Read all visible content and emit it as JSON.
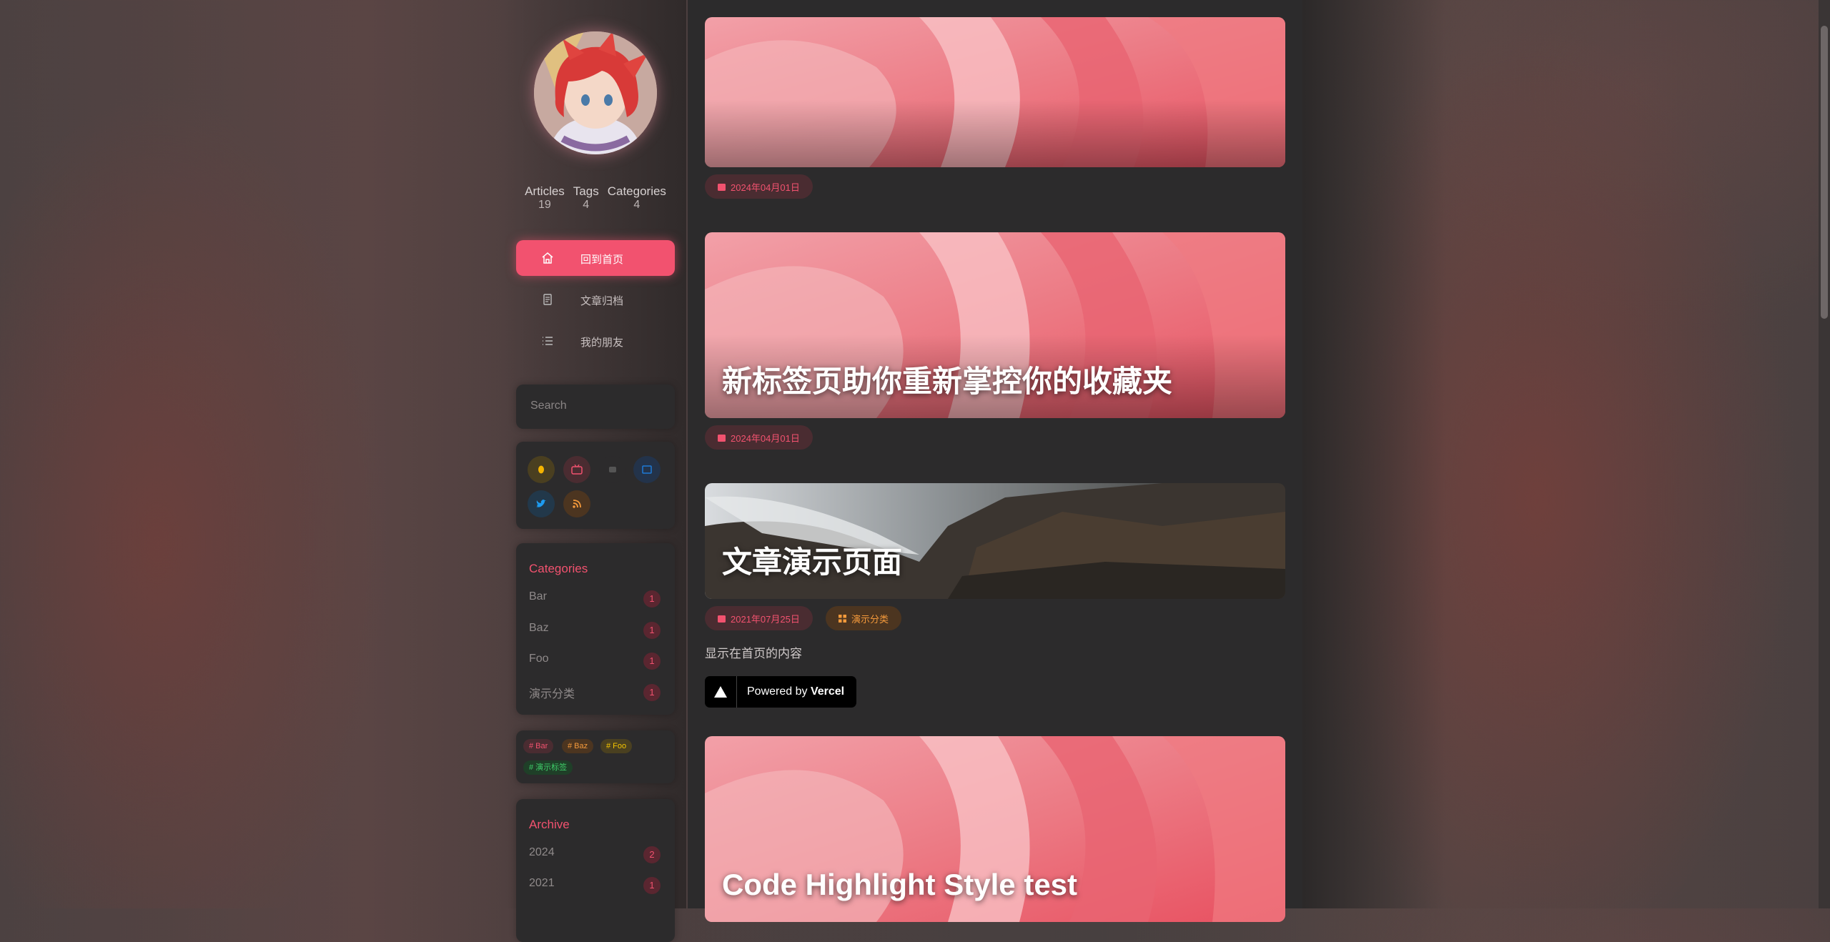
{
  "profile": {
    "avatar_icon": "avatar-anime-red-hair"
  },
  "stats": [
    {
      "label": "Articles",
      "value": "19"
    },
    {
      "label": "Tags",
      "value": "4"
    },
    {
      "label": "Categories",
      "value": "4"
    }
  ],
  "nav": [
    {
      "label": "回到首页",
      "icon": "home-icon",
      "active": true
    },
    {
      "label": "文章归档",
      "icon": "archive-icon",
      "active": false
    },
    {
      "label": "我的朋友",
      "icon": "list-icon",
      "active": false
    }
  ],
  "search": {
    "placeholder": "Search"
  },
  "social": [
    {
      "icon": "qq-icon",
      "color": "#f5b400"
    },
    {
      "icon": "bilibili-icon",
      "color": "#f2526f"
    },
    {
      "icon": "github-icon",
      "color": "#555555"
    },
    {
      "icon": "zhihu-icon",
      "color": "#1e7ad6"
    },
    {
      "icon": "twitter-icon",
      "color": "#1d9bf0"
    },
    {
      "icon": "rss-icon",
      "color": "#f59a3b"
    }
  ],
  "categories": {
    "title": "Categories",
    "items": [
      {
        "name": "Bar",
        "count": "1"
      },
      {
        "name": "Baz",
        "count": "1"
      },
      {
        "name": "Foo",
        "count": "1"
      },
      {
        "name": "演示分类",
        "count": "1"
      }
    ]
  },
  "tags": [
    {
      "label": "# Bar",
      "color": "#f2526f",
      "bg": "#4a2c31"
    },
    {
      "label": "# Baz",
      "color": "#f59a3b",
      "bg": "#4c3520"
    },
    {
      "label": "# Foo",
      "color": "#f5c400",
      "bg": "#4a4020"
    },
    {
      "label": "# 演示标签",
      "color": "#3fcf6a",
      "bg": "#1f3f28"
    }
  ],
  "archive": {
    "title": "Archive",
    "items": [
      {
        "year": "2024",
        "count": "2"
      },
      {
        "year": "2021",
        "count": "1"
      }
    ]
  },
  "posts": [
    {
      "title": "",
      "date": "2024年04月01日"
    },
    {
      "title": "新标签页助你重新掌控你的收藏夹",
      "date": "2024年04月01日"
    },
    {
      "title": "文章演示页面",
      "date": "2021年07月25日",
      "category": "演示分类",
      "excerpt": "显示在首页的内容"
    },
    {
      "title": "Code Highlight Style test"
    }
  ],
  "vercel": {
    "prefix": "Powered by",
    "brand": "Vercel"
  },
  "accent": "#f2526f"
}
